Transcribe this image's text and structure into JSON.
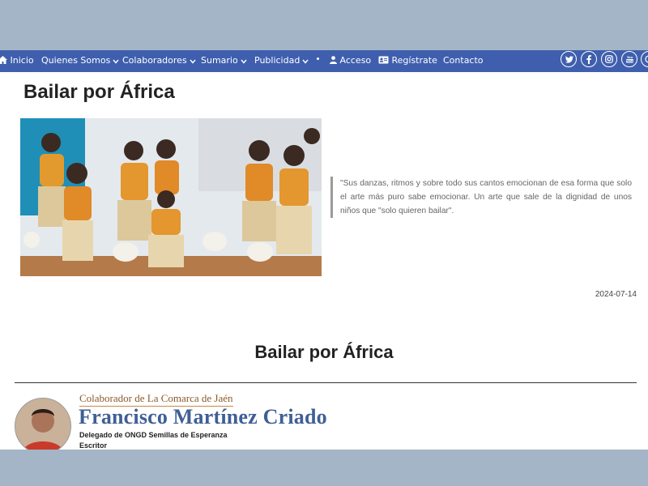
{
  "nav": {
    "items": [
      {
        "label": "Inicio"
      },
      {
        "label": "Quienes Somos"
      },
      {
        "label": "Colaboradores"
      },
      {
        "label": "Sumario"
      },
      {
        "label": "Publicidad"
      },
      {
        "label": "Acceso"
      },
      {
        "label": "Regístrate"
      },
      {
        "label": "Contacto"
      }
    ],
    "bg_color": "#3f5fae",
    "social_icons": [
      "twitter-icon",
      "facebook-icon",
      "instagram-icon",
      "youtube-icon",
      "whatsapp-icon"
    ]
  },
  "article": {
    "title": "Bailar por África",
    "quote": "\"Sus danzas, ritmos y sobre todo sus cantos emocionan de esa forma que solo el arte más puro sabe emocionar. Un arte que sale de la dignidad de unos niños que \"solo quieren bailar\".",
    "date": "2024-07-14",
    "subtitle": "Bailar por África"
  },
  "author": {
    "collab_label": "Colaborador de La Comarca de Jaén",
    "name": "Francisco Martínez Criado",
    "role_line1": "Delegado de ONGD Semillas de Esperanza",
    "role_line2": "Escritor"
  }
}
